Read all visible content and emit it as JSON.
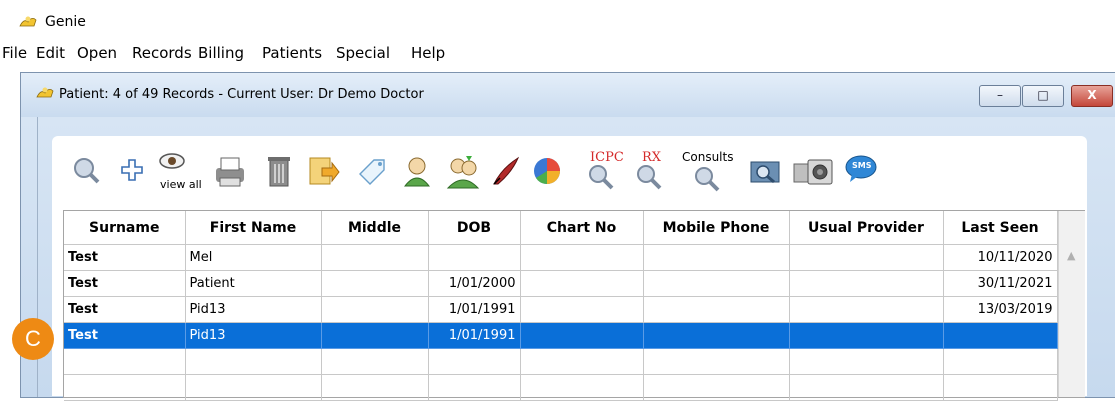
{
  "app": {
    "title": "Genie"
  },
  "menu": [
    "File",
    "Edit",
    "Open",
    "Records",
    "Billing",
    "Patients",
    "Special",
    "Help"
  ],
  "child_window": {
    "title": "Patient: 4 of 49 Records - Current User: Dr Demo Doctor",
    "buttons": {
      "minimize": "–",
      "maximize": "□",
      "close": "X"
    }
  },
  "toolbar": {
    "view_all_label": "view all",
    "icpc_label": "ICPC",
    "rx_label": "RX",
    "consults_label": "Consults",
    "sms_label": "SMS",
    "icons": [
      "search-icon",
      "add-icon",
      "view-all-icon",
      "printer-icon",
      "trash-icon",
      "export-icon",
      "tag-icon",
      "person-icon",
      "people-icon",
      "quill-icon",
      "pie-chart-icon",
      "icpc-search-icon",
      "rx-search-icon",
      "consults-search-icon",
      "image-viewer-icon",
      "camera-icon",
      "sms-icon"
    ]
  },
  "table": {
    "columns": [
      "Surname",
      "First Name",
      "Middle",
      "DOB",
      "Chart No",
      "Mobile Phone",
      "Usual Provider",
      "Last Seen"
    ],
    "rows": [
      [
        "Test",
        "Mel",
        "",
        "",
        "",
        "",
        "",
        "10/11/2020"
      ],
      [
        "Test",
        "Patient",
        "",
        "1/01/2000",
        "",
        "",
        "",
        "30/11/2021"
      ],
      [
        "Test",
        "Pid13",
        "",
        "1/01/1991",
        "",
        "",
        "",
        "13/03/2019"
      ],
      [
        "Test",
        "Pid13",
        "",
        "1/01/1991",
        "",
        "",
        "",
        ""
      ],
      [
        "",
        "",
        "",
        "",
        "",
        "",
        "",
        ""
      ],
      [
        "",
        "",
        "",
        "",
        "",
        "",
        "",
        ""
      ]
    ],
    "selected_row": 3
  },
  "annotation": {
    "badge_label": "C"
  },
  "colors": {
    "selection": "#0a6fd8",
    "badge": "#ee8a14"
  }
}
